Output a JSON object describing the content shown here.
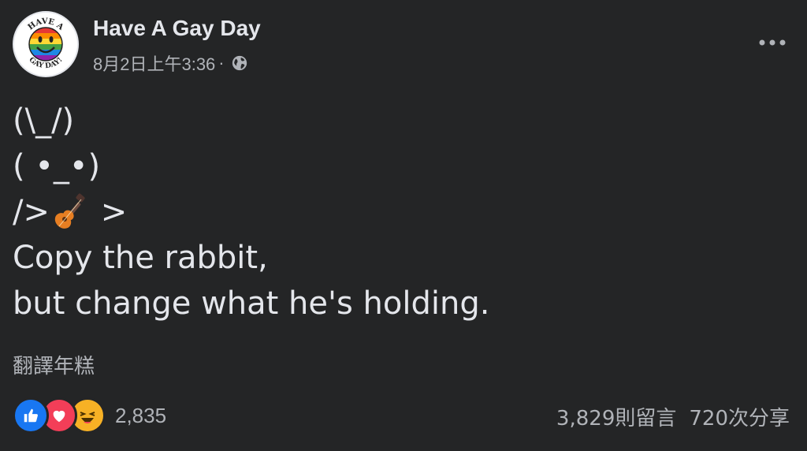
{
  "post": {
    "author": "Have A Gay Day",
    "avatar_text_top": "HAVE A",
    "avatar_text_bottom": "GAY DAY!",
    "timestamp": "8月2日上午3:36",
    "separator": "·",
    "privacy_icon": "globe-icon",
    "more_icon": "ellipsis-icon",
    "content_lines": {
      "line1": "(\\_/)",
      "line2": "( •_•)",
      "line3_start": "/>",
      "line3_icon": "guitar-emoji",
      "line3_end": " >",
      "line4": "Copy the rabbit,",
      "line5": "but change what he's holding."
    },
    "translate_label": "翻譯年糕"
  },
  "engagement": {
    "reaction_icons": [
      "like-icon",
      "love-icon",
      "haha-icon"
    ],
    "reaction_count": "2,835",
    "comments": "3,829則留言",
    "shares": "720次分享"
  },
  "colors": {
    "background": "#242526",
    "text_primary": "#e4e6eb",
    "text_secondary": "#b0b3b8",
    "like_blue": "#1877f2",
    "love_red": "#f33e58",
    "haha_yellow": "#f7b125"
  }
}
